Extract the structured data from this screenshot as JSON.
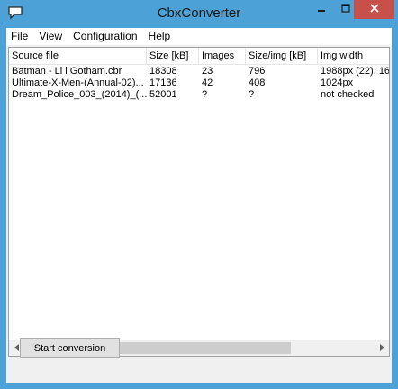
{
  "window": {
    "title": "CbxConverter"
  },
  "menu": [
    {
      "label": "File"
    },
    {
      "label": "View"
    },
    {
      "label": "Configuration"
    },
    {
      "label": "Help"
    }
  ],
  "table": {
    "columns": [
      "Source file",
      "Size [kB]",
      "Images",
      "Size/img [kB]",
      "Img width"
    ],
    "rows": [
      [
        "Batman - Li l Gotham.cbr",
        "18308",
        "23",
        "796",
        "1988px (22), 16"
      ],
      [
        "Ultimate-X-Men-(Annual-02)...",
        "17136",
        "42",
        "408",
        "1024px"
      ],
      [
        "Dream_Police_003_(2014)_(...",
        "52001",
        "?",
        "?",
        "not checked"
      ]
    ]
  },
  "scrollbar": {
    "position_fraction": 0.0
  },
  "buttons": {
    "start_label": "Start conversion"
  },
  "colors": {
    "titlebar": "#4ca1d6",
    "close_button": "#c7504a"
  }
}
